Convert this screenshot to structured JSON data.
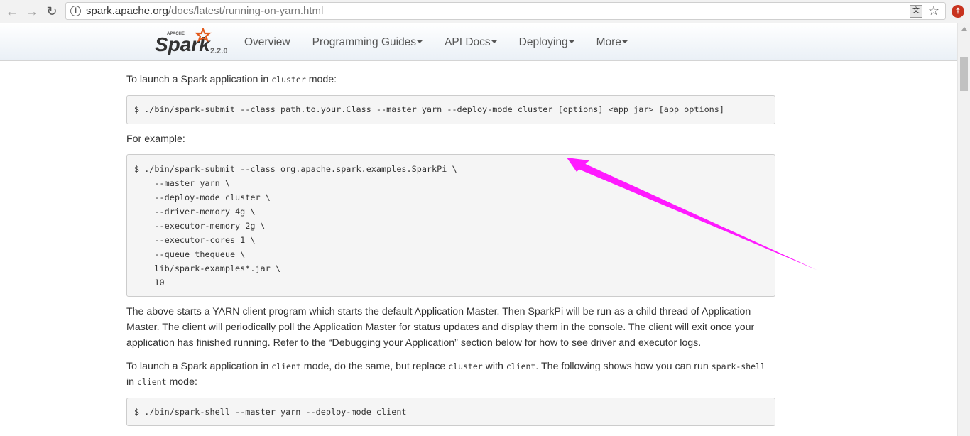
{
  "browser": {
    "url_host": "spark.apache.org",
    "url_path": "/docs/latest/running-on-yarn.html",
    "icons": [
      "back-icon",
      "forward-icon",
      "reload-icon",
      "info-icon",
      "translate-icon",
      "star-icon",
      "extension-icon"
    ]
  },
  "navbar": {
    "logo_apache": "APACHE",
    "logo_text": "Spark",
    "version": "2.2.0",
    "items": [
      {
        "label": "Overview",
        "dropdown": false
      },
      {
        "label": "Programming Guides",
        "dropdown": true
      },
      {
        "label": "API Docs",
        "dropdown": true
      },
      {
        "label": "Deploying",
        "dropdown": true
      },
      {
        "label": "More",
        "dropdown": true
      }
    ]
  },
  "content": {
    "launch_cluster": {
      "pre": "To launch a Spark application in ",
      "code": "cluster",
      "post": " mode:"
    },
    "cluster_cmd": "$ ./bin/spark-submit --class path.to.your.Class --master yarn --deploy-mode cluster [options] <app jar> [app options]",
    "for_example": "For example:",
    "example_lines": [
      "$ ./bin/spark-submit --class org.apache.spark.examples.SparkPi \\",
      "    --master yarn \\",
      "    --deploy-mode cluster \\",
      "    --driver-memory 4g \\",
      "    --executor-memory 2g \\",
      "    --executor-cores 1 \\",
      "    --queue thequeue \\",
      "    lib/spark-examples*.jar \\",
      "    10"
    ],
    "above_lines": [
      "The above starts a YARN client program which starts the default Application Master. Then SparkPi will be run as a child thread of Application",
      "Master. The client will periodically poll the Application Master for status updates and display them in the console. The client will exit once your",
      "application has finished running. Refer to the “Debugging your Application” section below for how to see driver and executor logs."
    ],
    "client_para": {
      "t1": "To launch a Spark application in ",
      "c1": "client",
      "t2": " mode, do the same, but replace ",
      "c2": "cluster",
      "t3": " with ",
      "c3": "client",
      "t4": ". The following shows how you can run ",
      "c4": "spark-shell",
      "t5": "in ",
      "c5": "client",
      "t6": " mode:"
    },
    "client_cmd": "$ ./bin/spark-shell --master yarn --deploy-mode client"
  },
  "annotation": {
    "color": "#ff1aff"
  }
}
